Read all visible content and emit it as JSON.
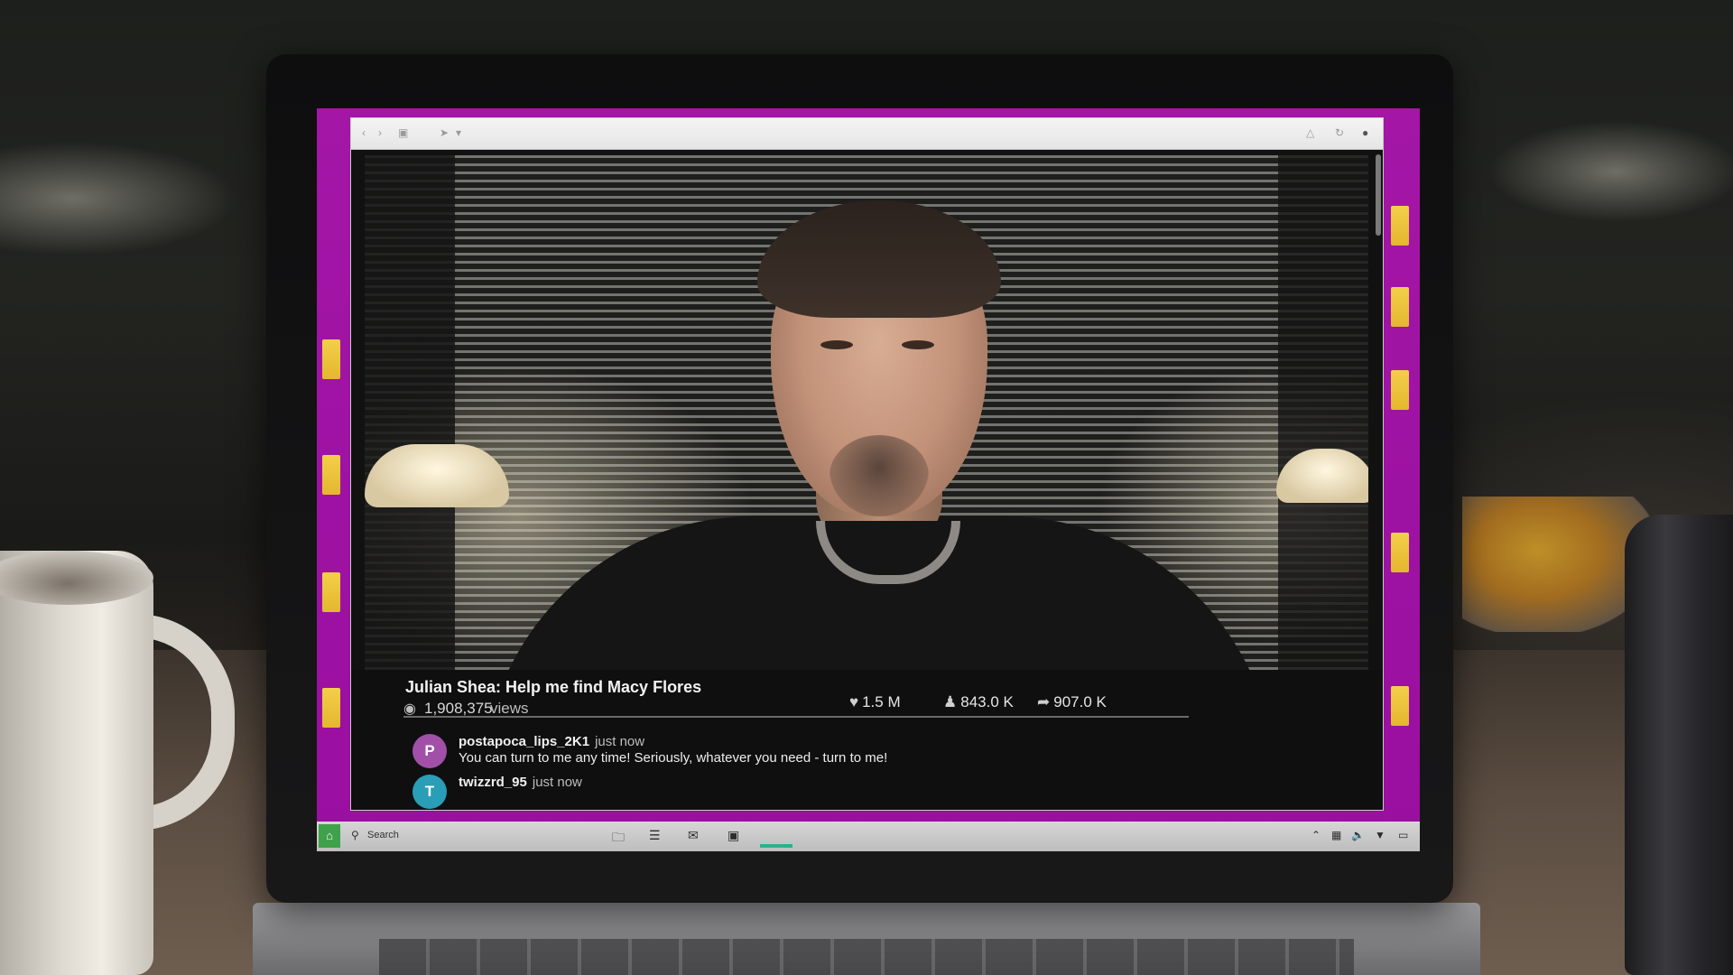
{
  "video": {
    "title": "Julian Shea: Help me find Macy Flores",
    "views_icon": "eye-icon",
    "views_count": "1,908,375",
    "views_label": "views",
    "likes": "1.5 M",
    "likes_icon": "heart-icon",
    "collects": "843.0 K",
    "collects_icon": "person-link-icon",
    "shares": "907.0 K",
    "shares_icon": "share-arrow-icon"
  },
  "comments": [
    {
      "avatar_letter": "P",
      "avatar_color": "#a24fa8",
      "user": "postapoca_lips_2K1",
      "time": "just now",
      "text": "You can turn to me any time! Seriously, whatever you need - turn to me!"
    },
    {
      "avatar_letter": "T",
      "avatar_color": "#2a9db7",
      "user": "twizzrd_95",
      "time": "just now",
      "text": ""
    }
  ],
  "taskbar": {
    "search_placeholder": "Search",
    "apps": [
      "folder-icon",
      "list-icon",
      "mail-icon",
      "window-icon",
      "active-app"
    ],
    "tray": [
      "chevron-up-icon",
      "network-icon",
      "volume-icon",
      "wifi-icon",
      "display-icon"
    ]
  },
  "desktop": {
    "background_color": "#a316a6",
    "icon_color": "#f3cf4a"
  }
}
